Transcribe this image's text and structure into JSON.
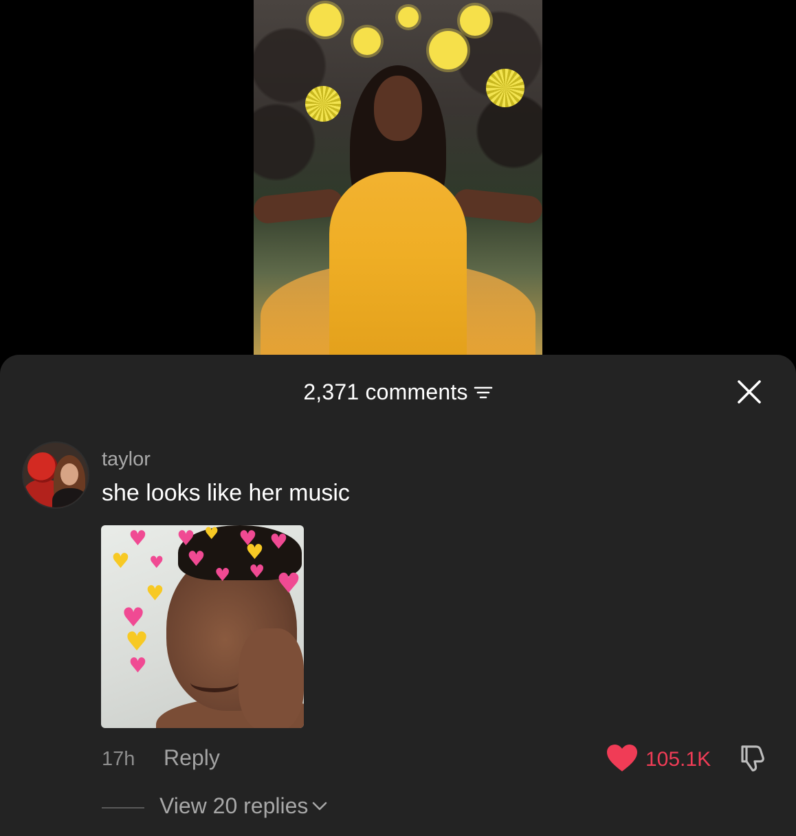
{
  "post": {
    "media_type": "photo"
  },
  "comments_sheet": {
    "count_label": "2,371 comments",
    "filter_icon": "filter-icon",
    "close_icon": "close-icon"
  },
  "comment": {
    "username": "taylor",
    "text": "she looks like her music",
    "attached_image": "reaction-meme-hearts",
    "timestamp": "17h",
    "reply_label": "Reply",
    "like_count": "105.1K",
    "liked": true,
    "like_color": "#f03c56",
    "view_replies_label": "View 20 replies"
  },
  "colors": {
    "sheet_background": "#232323",
    "page_background": "#000000",
    "secondary_text": "#a9a9a9"
  }
}
